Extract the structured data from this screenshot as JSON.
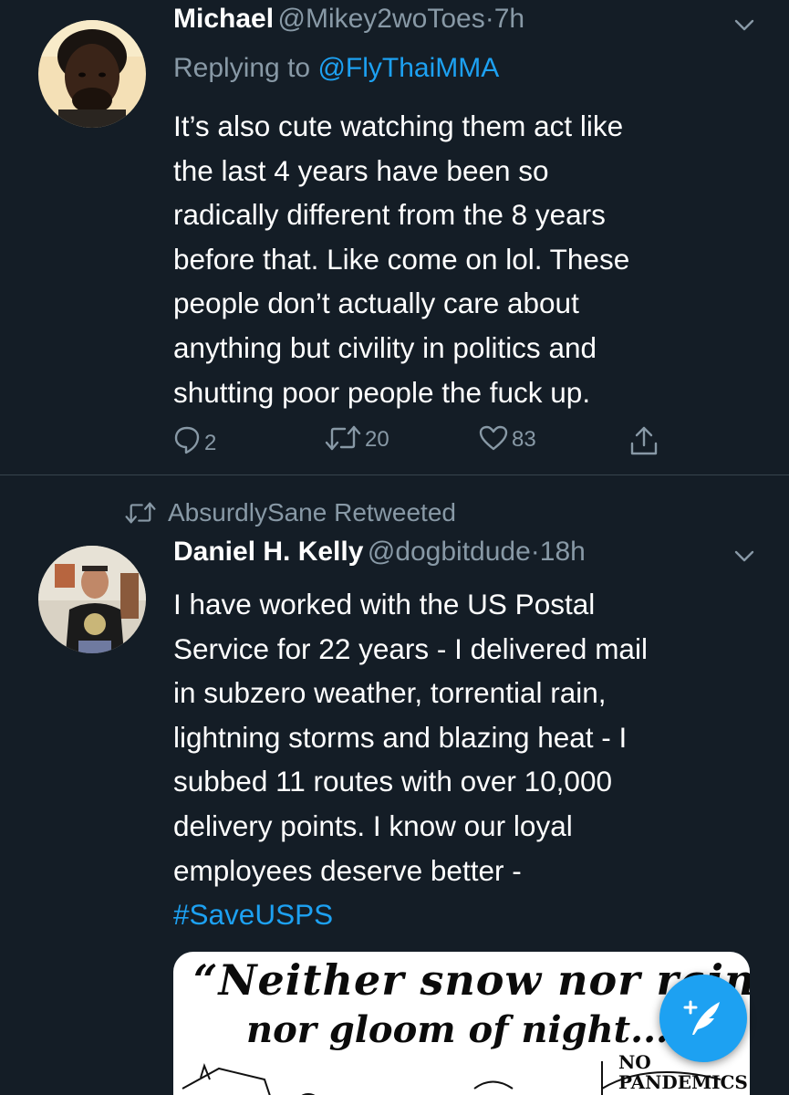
{
  "tweet1": {
    "name": "Michael",
    "handle": "@Mikey2woToes",
    "separator": "·",
    "time": "7h",
    "replying_label": "Replying to",
    "replying_mention": "@FlyThaiMMA",
    "lines": [
      "It’s also cute watching them act like",
      "the last 4 years have been so",
      "radically different from the 8 years",
      "before that. Like come on lol. These",
      "people don’t actually care about",
      "anything but civility in politics and",
      "shutting poor people the fuck up."
    ],
    "reply_count": "2",
    "retweet_count": "20",
    "like_count": "83"
  },
  "tweet2": {
    "retweet_context": "AbsurdlySane Retweeted",
    "name": "Daniel H. Kelly",
    "handle": "@dogbitdude",
    "separator": "·",
    "time": "18h",
    "lines": [
      "I have worked with the US Postal",
      "Service for 22 years - I delivered mail",
      "in subzero weather, torrential rain,",
      "lightning storms and blazing heat - I",
      "subbed 11 routes with over 10,000",
      "delivery points. I know our loyal",
      "employees deserve better -"
    ],
    "hashtag": "#SaveUSPS",
    "media": {
      "line1": "“Neither snow nor rain nor hea",
      "line2": "nor gloom of night...”",
      "corner1": "NO",
      "corner2": "PANDEMICS!!"
    }
  },
  "colors": {
    "background": "#141d26",
    "secondary_text": "#8899a6",
    "accent": "#1da1f2",
    "divider": "#38444d"
  },
  "icons": {
    "reply": "reply-icon",
    "retweet": "retweet-icon",
    "like": "heart-icon",
    "share": "share-icon",
    "caret": "chevron-down-icon",
    "compose": "compose-tweet-icon"
  }
}
